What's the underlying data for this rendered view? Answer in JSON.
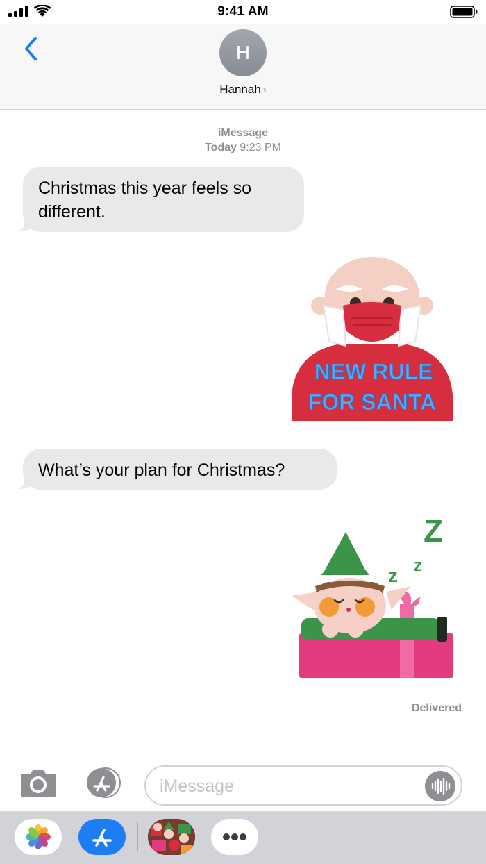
{
  "status": {
    "time": "9:41 AM"
  },
  "header": {
    "avatar_initial": "H",
    "contact_name": "Hannah",
    "chevron": "›"
  },
  "conversation": {
    "service": "iMessage",
    "date_label": "Today",
    "time_label": "9:23 PM",
    "messages": [
      {
        "from": "Hannah",
        "type": "text",
        "text": "Christmas this year feels so different."
      },
      {
        "from": "me",
        "type": "sticker",
        "icon": "santa-mask-sticker",
        "caption_line1": "NEW RULE",
        "caption_line2": "FOR SANTA"
      },
      {
        "from": "Hannah",
        "type": "text",
        "text": "What’s your plan for Christmas?"
      },
      {
        "from": "me",
        "type": "sticker",
        "icon": "sleeping-elf-sticker"
      }
    ],
    "delivery_status": "Delivered"
  },
  "input": {
    "placeholder": "iMessage"
  },
  "app_drawer": {
    "apps": [
      {
        "icon": "photos-app-icon"
      },
      {
        "icon": "app-store-icon"
      },
      {
        "icon": "christmas-stickers-app-icon"
      },
      {
        "icon": "more-apps-icon"
      }
    ]
  },
  "colors": {
    "accent_blue": "#1a7cf3",
    "bubble_gray": "#e9e9eb",
    "secondary_text": "#8e8e93",
    "santa_red": "#d62e3e",
    "caption_blue": "#5aa6f5",
    "elf_green": "#3b9447",
    "gift_pink": "#e23b80"
  }
}
